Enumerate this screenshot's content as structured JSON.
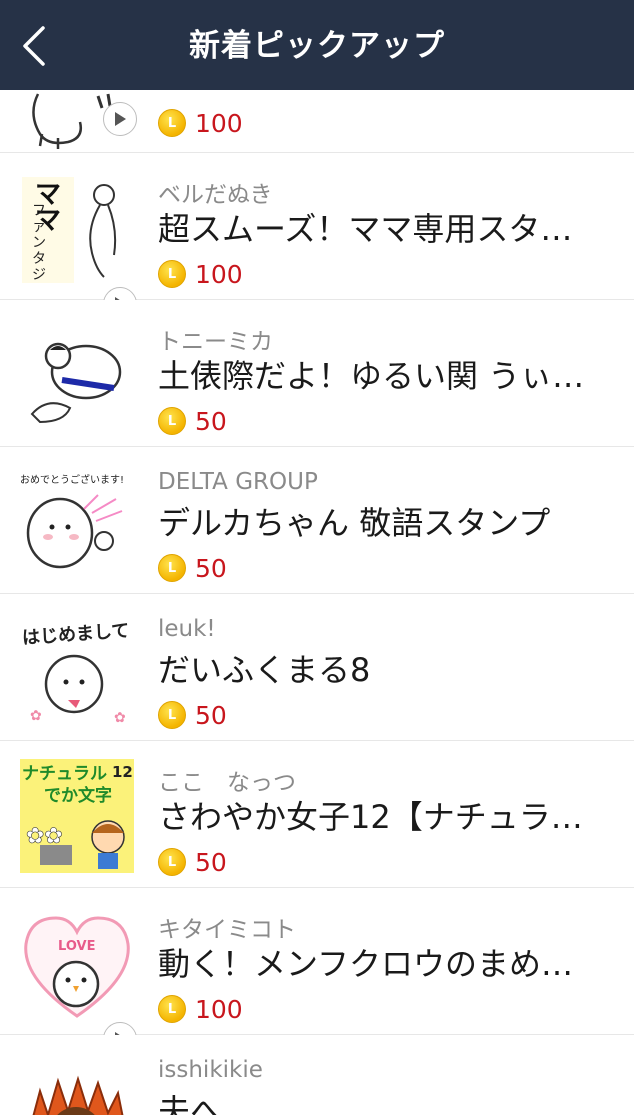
{
  "header": {
    "title": "新着ピックアップ"
  },
  "coin_letter": "L",
  "items": [
    {
      "creator": "",
      "name": "",
      "price": "100",
      "animated": true
    },
    {
      "creator": "ベルだぬき",
      "name": "超スムーズ！ママ専用スタ…",
      "price": "100",
      "animated": true
    },
    {
      "creator": "トニーミカ",
      "name": "土俵際だよ！ゆるい関 うぃ…",
      "price": "50",
      "animated": false
    },
    {
      "creator": "DELTA GROUP",
      "name": "デルカちゃん 敬語スタンプ",
      "price": "50",
      "animated": false
    },
    {
      "creator": "leuk!",
      "name": "だいふくまる8",
      "price": "50",
      "animated": false
    },
    {
      "creator": "ここ　なっつ",
      "name": "さわやか女子12【ナチュラ…",
      "price": "50",
      "animated": false
    },
    {
      "creator": "キタイミコト",
      "name": "動く！メンフクロウのまめ…",
      "price": "100",
      "animated": true
    },
    {
      "creator": "isshikikie",
      "name": "夫へ",
      "price": "",
      "animated": false
    }
  ],
  "thumb_text": {
    "mama": "ママ ファンタジー",
    "omedeto": "おめでとうございます!",
    "hajimemashite": "はじめまして",
    "natural_1": "ナチュラル",
    "natural_2": "でか文字",
    "natural_num": "12",
    "love": "LOVE"
  },
  "colors": {
    "header_bg": "#263247",
    "price": "#c8161d",
    "coin": "#f4b400"
  }
}
